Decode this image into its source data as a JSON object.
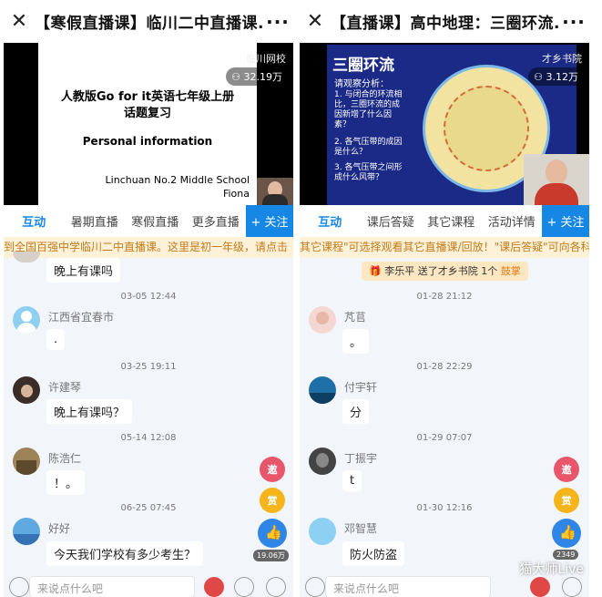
{
  "left": {
    "title": "【寒假直播课】临川二中直播课...",
    "close_glyph": "✕",
    "more_glyph": "···",
    "video": {
      "slide_line1": "人教版Go for it英语七年级上册",
      "slide_line2": "话题复习",
      "slide_line3": "Personal information",
      "slide_line4": "Linchuan No.2 Middle School",
      "slide_line5": "Fiona",
      "watermark": "临川网校",
      "viewers": "32.19万"
    },
    "tabs": [
      "互动",
      "暑期直播",
      "寒假直播",
      "更多直播"
    ],
    "follow_label": "+ 关注",
    "marquee": "到全国百强中学临川二中直播课。这里是初一年级，请点击",
    "messages": [
      {
        "time": "",
        "name": "",
        "text": "晚上有课吗"
      },
      {
        "time": "03-05 12:44",
        "name": "江西省宜春市",
        "text": "."
      },
      {
        "time": "03-25 19:11",
        "name": "许建琴",
        "text": "晚上有课吗？"
      },
      {
        "time": "05-14 12:08",
        "name": "陈浩仁",
        "text": "！。"
      },
      {
        "time": "06-25 07:45",
        "name": "好好",
        "text": "今天我们学校有多少考生？"
      }
    ],
    "invite_label": "邀",
    "reward_label": "赏",
    "like_count": "19.06万",
    "input_placeholder": "来说点什么吧"
  },
  "right": {
    "title": "【直播课】高中地理：三圈环流...",
    "close_glyph": "✕",
    "more_glyph": "···",
    "video": {
      "slide_title": "三圈环流",
      "slide_subtitle": "请观察分析：",
      "slide_q1": "1. 与闭合的环流相比，三圈环流的成因新增了什么因素？",
      "slide_q2": "2. 各气压带的成因是什么？",
      "slide_q3": "3. 各气压带之间形成什么风带？",
      "watermark": "才乡书院",
      "viewers": "3.12万"
    },
    "tabs": [
      "互动",
      "课后答疑",
      "其它课程",
      "活动详情"
    ],
    "follow_label": "+ 关注",
    "marquee": "其它课程\"可选择观看其它直播课/回放！\"课后答疑\"可向各科",
    "gift_text": "李乐平 送了才乡书院 1个",
    "gift_highlight": "鼓掌",
    "messages": [
      {
        "time": "01-28 21:12",
        "name": "芃苢",
        "text": "。"
      },
      {
        "time": "01-28 22:29",
        "name": "付宇轩",
        "text": "分"
      },
      {
        "time": "01-29 07:07",
        "name": "丁振宇",
        "text": "t"
      },
      {
        "time": "01-30 12:16",
        "name": "邓智慧",
        "text": "防火防盗"
      }
    ],
    "invite_label": "邀",
    "reward_label": "赏",
    "like_count": "2349",
    "input_placeholder": "来说点什么吧"
  },
  "source_watermark": "猫大师Live",
  "colors": {
    "accent": "#1787e6",
    "marquee_text": "#c37b1a",
    "invite": "#e8566b",
    "reward": "#f4b41a"
  }
}
